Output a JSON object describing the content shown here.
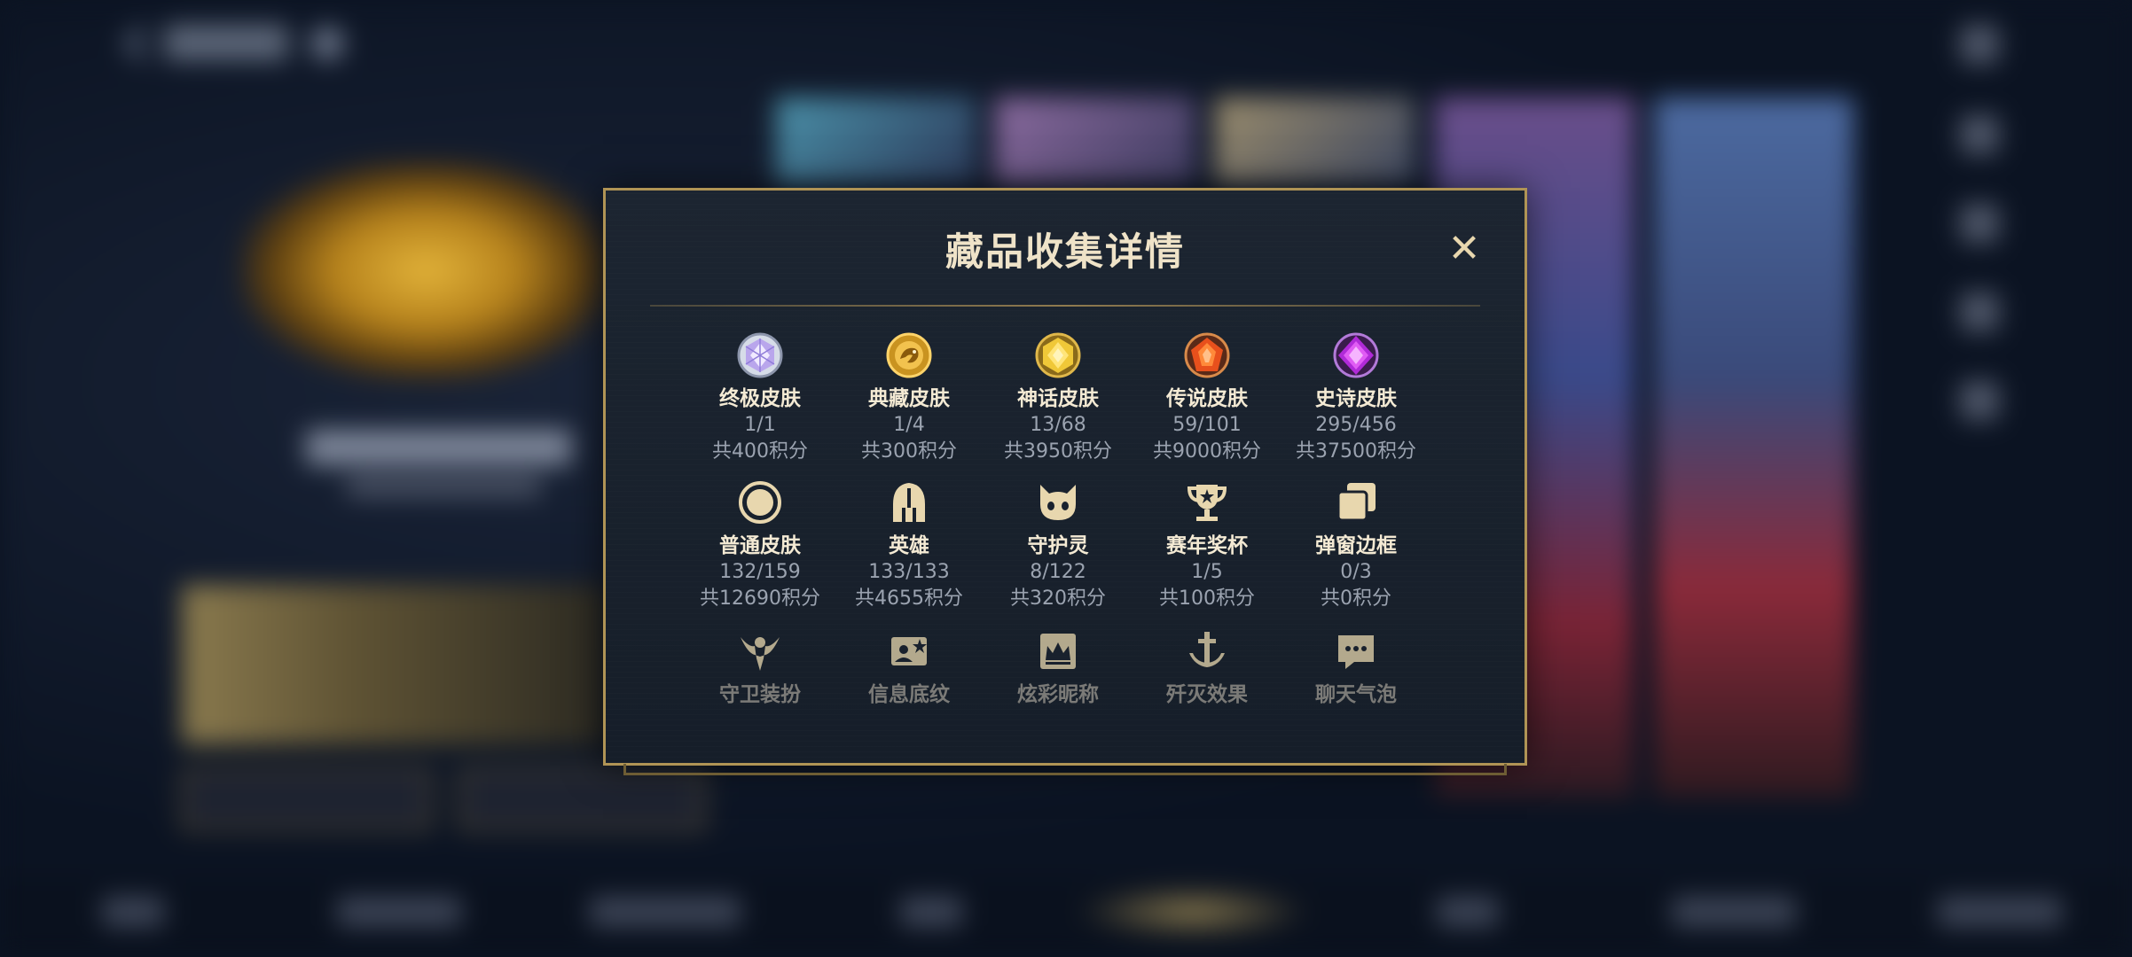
{
  "modal": {
    "title": "藏品收集详情",
    "close_glyph": "✕",
    "rows": [
      [
        {
          "icon": "ultimate-skin-gem-icon",
          "name": "终极皮肤",
          "count": "1/1",
          "points": "共400积分"
        },
        {
          "icon": "collection-skin-dragon-icon",
          "name": "典藏皮肤",
          "count": "1/4",
          "points": "共300积分"
        },
        {
          "icon": "myth-skin-gem-icon",
          "name": "神话皮肤",
          "count": "13/68",
          "points": "共3950积分"
        },
        {
          "icon": "legend-skin-gem-icon",
          "name": "传说皮肤",
          "count": "59/101",
          "points": "共9000积分"
        },
        {
          "icon": "epic-skin-gem-icon",
          "name": "史诗皮肤",
          "count": "295/456",
          "points": "共37500积分"
        }
      ],
      [
        {
          "icon": "normal-skin-ring-icon",
          "name": "普通皮肤",
          "count": "132/159",
          "points": "共12690积分"
        },
        {
          "icon": "hero-helmet-icon",
          "name": "英雄",
          "count": "133/133",
          "points": "共4655积分"
        },
        {
          "icon": "guardian-spirit-icon",
          "name": "守护灵",
          "count": "8/122",
          "points": "共320积分"
        },
        {
          "icon": "season-trophy-icon",
          "name": "赛年奖杯",
          "count": "1/5",
          "points": "共100积分"
        },
        {
          "icon": "popup-frame-icon",
          "name": "弹窗边框",
          "count": "0/3",
          "points": "共0积分"
        }
      ],
      [
        {
          "icon": "guard-outfit-icon",
          "name": "守卫装扮"
        },
        {
          "icon": "info-background-icon",
          "name": "信息底纹"
        },
        {
          "icon": "colorful-nickname-icon",
          "name": "炫彩昵称"
        },
        {
          "icon": "kill-effect-icon",
          "name": "歼灭效果"
        },
        {
          "icon": "chat-bubble-icon",
          "name": "聊天气泡"
        }
      ]
    ]
  },
  "colors": {
    "gold_border": "#b09455",
    "panel_bg": "#1a222e",
    "title_text": "#efe3c8",
    "count_text": "#9ba3b0",
    "icon_gold": "#e8d7ae"
  }
}
